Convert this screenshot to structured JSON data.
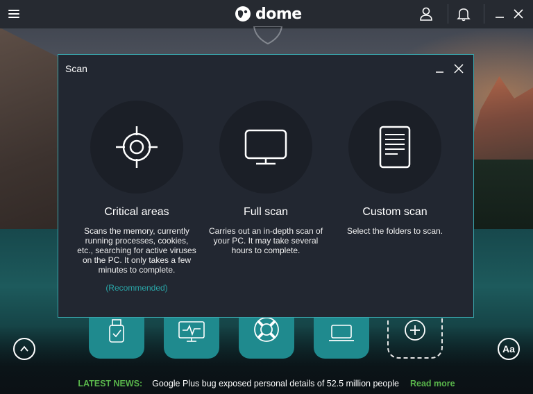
{
  "app": {
    "logo_text": "dome",
    "colors": {
      "accent": "#2aa6a8",
      "tile": "#1f8a8e",
      "dialog_bg": "#222731",
      "dialog_border": "#3aa6ac",
      "news_green": "#59b64b"
    }
  },
  "topbar": {
    "icons": [
      "menu-icon",
      "user-icon",
      "notifications-icon",
      "minimize-icon",
      "close-icon"
    ]
  },
  "scan_dialog": {
    "title": "Scan",
    "options": [
      {
        "icon": "target-icon",
        "title": "Critical areas",
        "description": "Scans the memory, currently running processes, cookies, etc., searching for active viruses on the PC. It only takes a few minutes to complete.",
        "recommended": "(Recommended)"
      },
      {
        "icon": "monitor-icon",
        "title": "Full scan",
        "description": "Carries out an in-depth scan of your PC. It may take several hours to complete."
      },
      {
        "icon": "document-icon",
        "title": "Custom scan",
        "description": "Select the folders to scan."
      }
    ]
  },
  "tiles": [
    "usb-protection-icon",
    "process-monitor-icon",
    "rescue-kit-icon",
    "laptop-icon",
    "add-icon"
  ],
  "bottom": {
    "font_button_label": "Aa"
  },
  "news": {
    "label": "LATEST NEWS:",
    "headline": "Google Plus bug exposed personal details of 52.5 million people",
    "link": "Read more"
  }
}
